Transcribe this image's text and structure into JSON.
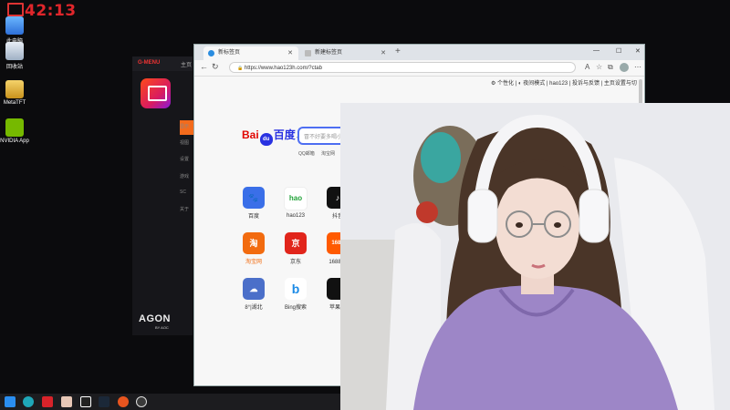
{
  "clock": {
    "time": "42:13"
  },
  "desktop": {
    "icons": [
      {
        "label": "此电脑",
        "icon": "computer-icon"
      },
      {
        "label": "回收站",
        "icon": "recycle-bin-icon"
      },
      {
        "label": "MetaTFT",
        "icon": "metatft-icon"
      },
      {
        "label": "NVIDIA App",
        "icon": "nvidia-icon"
      }
    ]
  },
  "agon_app": {
    "brand": "G-MENU",
    "home": "主页",
    "wordmark": "AGON",
    "sub": "BY AOC",
    "menu": [
      "显示",
      "视图",
      "设置",
      "游戏",
      "SC",
      "关于"
    ]
  },
  "browser": {
    "tabs": [
      {
        "label": "新标签页",
        "active": true
      },
      {
        "label": "新建标签页",
        "active": false
      }
    ],
    "url": "https://www.hao123h.com/?ctab",
    "toolbar_aa": "A",
    "toplinks": "⚙ 个性化 | ◐ 夜间模式 | hao123 | 投诉与反馈 | 主页设置与切",
    "baidu": {
      "bai": "Bai",
      "du_char": "du",
      "chinese": "百度",
      "caret": "⌄"
    },
    "search_placeholder": "冒不好要多喝小",
    "quick_links": [
      "QQ邮箱",
      "淘宝网"
    ],
    "apps": [
      {
        "label": "百度",
        "icon": "baidu-icon",
        "glyph": "🐾",
        "color": "#3a6fe8"
      },
      {
        "label": "hao123",
        "icon": "hao123-icon",
        "glyph": "hao",
        "color": "#ffffff"
      },
      {
        "label": "抖音",
        "icon": "douyin-icon",
        "glyph": "♪",
        "color": "#111111"
      },
      {
        "label": "淘宝网",
        "icon": "taobao-icon",
        "glyph": "淘",
        "color": "#f26b0f"
      },
      {
        "label": "京东",
        "icon": "jd-icon",
        "glyph": "京",
        "color": "#e1251b"
      },
      {
        "label": "1688网",
        "icon": "alibaba-1688-icon",
        "glyph": "1688",
        "color": "#ff5a00"
      },
      {
        "label": "8°|湖北",
        "icon": "weather-icon",
        "glyph": "☁",
        "color": "#4b6fc9"
      },
      {
        "label": "Bing搜索",
        "icon": "bing-icon",
        "glyph": "b",
        "color": "#ffffff"
      },
      {
        "label": "苹果官",
        "icon": "apple-icon",
        "glyph": "",
        "color": "#111111"
      }
    ]
  },
  "taskbar": {
    "icons": [
      "windows-start-icon",
      "edge-icon",
      "app-red-icon",
      "app-face-icon",
      "g-app-icon",
      "steam-icon",
      "app-orange-icon",
      "obs-icon"
    ]
  }
}
